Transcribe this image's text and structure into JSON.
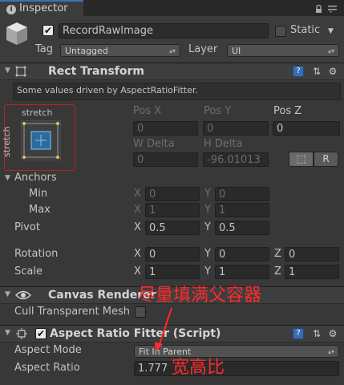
{
  "window": {
    "tab_label": "Inspector",
    "tab_icon": "info-icon",
    "lock_icon": "lock-icon",
    "menu_icon": "menu-icon"
  },
  "header": {
    "object_name": "RecordRawImage",
    "static_label": "Static",
    "tag_label": "Tag",
    "tag_value": "Untagged",
    "layer_label": "Layer",
    "layer_value": "UI"
  },
  "rect_transform": {
    "title": "Rect Transform",
    "info_note": "Some values driven by AspectRatioFitter.",
    "preset_top_label": "stretch",
    "preset_side_label": "stretch",
    "pos_x_label": "Pos X",
    "pos_y_label": "Pos Y",
    "pos_z_label": "Pos Z",
    "pos_x": "0",
    "pos_y": "0",
    "pos_z": "0",
    "w_delta_label": "W Delta",
    "h_delta_label": "H Delta",
    "w_delta": "0",
    "h_delta": "-96.01013",
    "blueprint_button": "⬚",
    "raw_button": "R",
    "anchors_label": "Anchors",
    "min_label": "Min",
    "max_label": "Max",
    "anchor_min_x": "0",
    "anchor_min_y": "0",
    "anchor_max_x": "1",
    "anchor_max_y": "1",
    "pivot_label": "Pivot",
    "pivot_x": "0.5",
    "pivot_y": "0.5",
    "rotation_label": "Rotation",
    "rot_x": "0",
    "rot_y": "0",
    "rot_z": "0",
    "scale_label": "Scale",
    "scale_x": "1",
    "scale_y": "1",
    "scale_z": "1",
    "x": "X",
    "y": "Y",
    "z": "Z"
  },
  "canvas_renderer": {
    "title": "Canvas Renderer",
    "cull_label": "Cull Transparent Mesh"
  },
  "aspect_ratio_fitter": {
    "title": "Aspect Ratio Fitter (Script)",
    "mode_label": "Aspect Mode",
    "mode_value": "Fit In Parent",
    "ratio_label": "Aspect Ratio",
    "ratio_value": "1.777"
  },
  "annotations": {
    "fill_parent": "尽量填满父容器",
    "aspect_ratio": "宽高比"
  },
  "colors": {
    "accent": "#3a72b0",
    "annotation": "#ff2a2a"
  }
}
